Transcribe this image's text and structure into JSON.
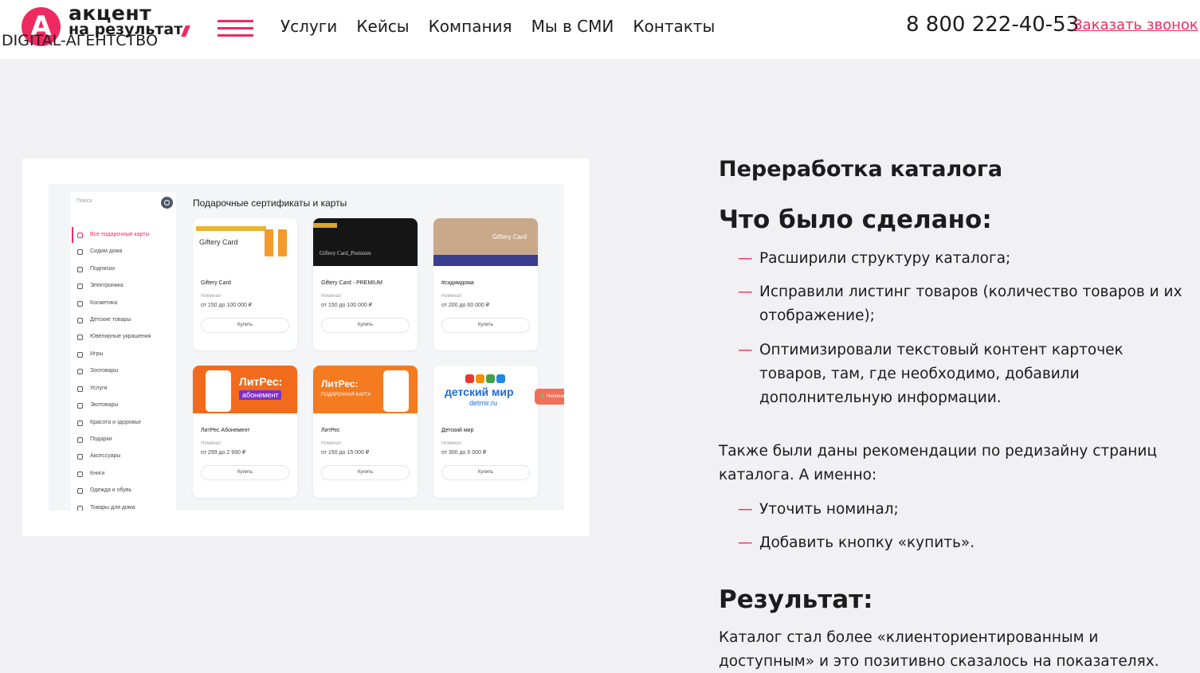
{
  "header": {
    "logo_line1": "акцент",
    "logo_line2": "на результат",
    "logo_subtitle": "DIGITAL-АГЕНТСТВО",
    "nav": [
      "Услуги",
      "Кейсы",
      "Компания",
      "Мы в СМИ",
      "Контакты"
    ],
    "phone": "8 800 222-40-53",
    "callback": "Заказать звонок"
  },
  "screenshot": {
    "search_placeholder": "Поиск",
    "title": "Подарочные сертификаты и карты",
    "categories": [
      "Все подарочные карты",
      "Сидим дома",
      "Подписки",
      "Электроника",
      "Косметика",
      "Детские товары",
      "Ювелирные украшения",
      "Игры",
      "Зоотовары",
      "Услуги",
      "Экотовары",
      "Красота и здоровье",
      "Подарки",
      "Аксессуары",
      "Книги",
      "Одежда и обувь",
      "Товары для дома"
    ],
    "image_texts": {
      "giftery": "Giftery Card",
      "premium": "Giftery Card_Premium",
      "home": "Giftery Card",
      "litres": "ЛитРес:",
      "abonement": "абонемент",
      "litres_sub": "ПОДАРОЧНАЯ КАРТА",
      "detmir": "детский мир",
      "detmir_url": "detmir.ru"
    },
    "nominal_label": "Номинал",
    "buy_label": "Купить",
    "cards": [
      {
        "name": "Giftery Card",
        "value": "от 150 до 100 000 ₽"
      },
      {
        "name": "Giftery Card - PREMIUM",
        "value": "от 150 до 100 000 ₽"
      },
      {
        "name": "#сидимдома",
        "value": "от 200 до 60 000 ₽"
      },
      {
        "name": "ЛитРес Абонемент",
        "value": "от 299 до 2 990 ₽"
      },
      {
        "name": "ЛитРес",
        "value": "от 150 до 15 000 ₽"
      },
      {
        "name": "Детский мир",
        "value": "от 300 до 5 000 ₽"
      }
    ],
    "chat": "Напишите нам, м"
  },
  "content": {
    "heading": "Переработка каталога",
    "done_heading": "Что было сделано:",
    "done_items": [
      "Расширили структуру каталога;",
      "Исправили листинг товаров (количество товаров и их отображение);",
      "Оптимизировали текстовый контент карточек товаров, там, где необходимо, добавили дополнительную информации."
    ],
    "recommendation": "Также были даны рекомендации по редизайну страниц каталога. А именно:",
    "recommendation_items": [
      "Уточить номинал;",
      "Добавить кнопку «купить»."
    ],
    "result_heading": "Результат:",
    "result_text": "Каталог стал более «клиенториентированным и доступным» и это позитивно сказалось на показателях."
  },
  "colors": {
    "accent": "#ee2a61",
    "background": "#f1f1f3"
  }
}
